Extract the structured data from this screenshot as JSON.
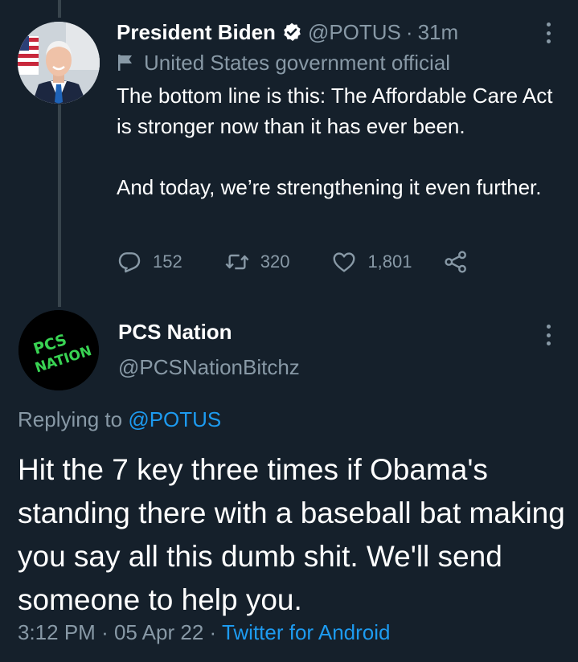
{
  "parent_tweet": {
    "display_name": "President Biden",
    "handle": "@POTUS",
    "separator": "·",
    "time": "31m",
    "label": "United States government official",
    "body_p1": "The bottom line is this: The Affordable Care Act is stronger now than it has ever been.",
    "body_p2": "And today, we’re strengthening it even further.",
    "replies": "152",
    "retweets": "320",
    "likes": "1,801"
  },
  "reply_tweet": {
    "display_name": "PCS Nation",
    "handle": "@PCSNationBitchz",
    "avatar_text_line1": "PCS",
    "avatar_text_line2": "NATION",
    "replying_prefix": "Replying to",
    "replying_to": "@POTUS",
    "body": "Hit the 7 key three times if Obama's standing there with a baseball bat making you say all this dumb shit. We'll send someone to help you.",
    "time": "3:12 PM",
    "separator1": "·",
    "date": "05 Apr 22",
    "separator2": "·",
    "source": "Twitter for Android"
  },
  "colors": {
    "background": "#15202b",
    "text_primary": "#ffffff",
    "text_secondary": "#8899a6",
    "accent": "#1d9bf0",
    "thread_line": "#38444d",
    "avatar_logo_green": "#39d353"
  },
  "icons": [
    "verified-badge-icon",
    "more-options-icon",
    "government-flag-icon",
    "reply-icon",
    "retweet-icon",
    "like-icon",
    "share-icon"
  ]
}
